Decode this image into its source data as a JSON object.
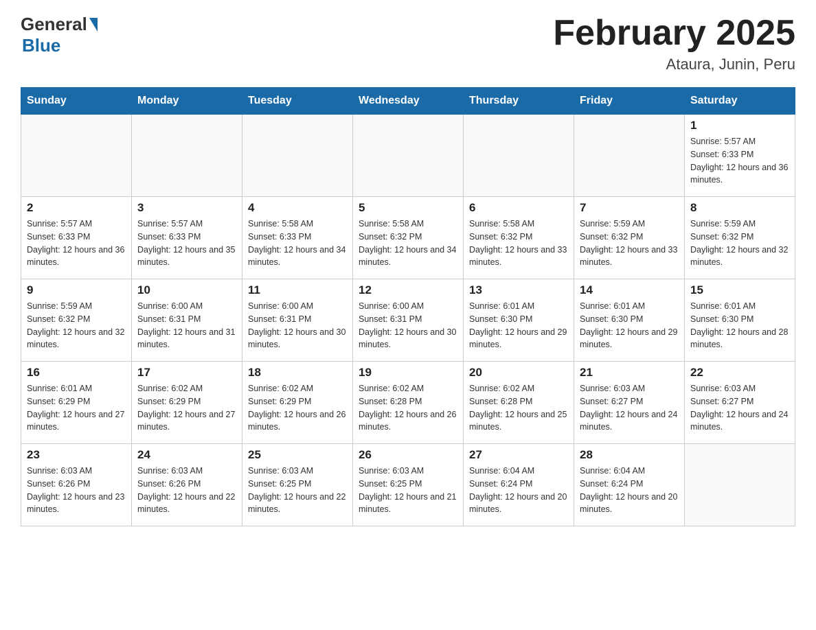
{
  "header": {
    "logo_general": "General",
    "logo_blue": "Blue",
    "title": "February 2025",
    "subtitle": "Ataura, Junin, Peru"
  },
  "days_of_week": [
    "Sunday",
    "Monday",
    "Tuesday",
    "Wednesday",
    "Thursday",
    "Friday",
    "Saturday"
  ],
  "weeks": [
    [
      {
        "day": "",
        "info": ""
      },
      {
        "day": "",
        "info": ""
      },
      {
        "day": "",
        "info": ""
      },
      {
        "day": "",
        "info": ""
      },
      {
        "day": "",
        "info": ""
      },
      {
        "day": "",
        "info": ""
      },
      {
        "day": "1",
        "info": "Sunrise: 5:57 AM\nSunset: 6:33 PM\nDaylight: 12 hours and 36 minutes."
      }
    ],
    [
      {
        "day": "2",
        "info": "Sunrise: 5:57 AM\nSunset: 6:33 PM\nDaylight: 12 hours and 36 minutes."
      },
      {
        "day": "3",
        "info": "Sunrise: 5:57 AM\nSunset: 6:33 PM\nDaylight: 12 hours and 35 minutes."
      },
      {
        "day": "4",
        "info": "Sunrise: 5:58 AM\nSunset: 6:33 PM\nDaylight: 12 hours and 34 minutes."
      },
      {
        "day": "5",
        "info": "Sunrise: 5:58 AM\nSunset: 6:32 PM\nDaylight: 12 hours and 34 minutes."
      },
      {
        "day": "6",
        "info": "Sunrise: 5:58 AM\nSunset: 6:32 PM\nDaylight: 12 hours and 33 minutes."
      },
      {
        "day": "7",
        "info": "Sunrise: 5:59 AM\nSunset: 6:32 PM\nDaylight: 12 hours and 33 minutes."
      },
      {
        "day": "8",
        "info": "Sunrise: 5:59 AM\nSunset: 6:32 PM\nDaylight: 12 hours and 32 minutes."
      }
    ],
    [
      {
        "day": "9",
        "info": "Sunrise: 5:59 AM\nSunset: 6:32 PM\nDaylight: 12 hours and 32 minutes."
      },
      {
        "day": "10",
        "info": "Sunrise: 6:00 AM\nSunset: 6:31 PM\nDaylight: 12 hours and 31 minutes."
      },
      {
        "day": "11",
        "info": "Sunrise: 6:00 AM\nSunset: 6:31 PM\nDaylight: 12 hours and 30 minutes."
      },
      {
        "day": "12",
        "info": "Sunrise: 6:00 AM\nSunset: 6:31 PM\nDaylight: 12 hours and 30 minutes."
      },
      {
        "day": "13",
        "info": "Sunrise: 6:01 AM\nSunset: 6:30 PM\nDaylight: 12 hours and 29 minutes."
      },
      {
        "day": "14",
        "info": "Sunrise: 6:01 AM\nSunset: 6:30 PM\nDaylight: 12 hours and 29 minutes."
      },
      {
        "day": "15",
        "info": "Sunrise: 6:01 AM\nSunset: 6:30 PM\nDaylight: 12 hours and 28 minutes."
      }
    ],
    [
      {
        "day": "16",
        "info": "Sunrise: 6:01 AM\nSunset: 6:29 PM\nDaylight: 12 hours and 27 minutes."
      },
      {
        "day": "17",
        "info": "Sunrise: 6:02 AM\nSunset: 6:29 PM\nDaylight: 12 hours and 27 minutes."
      },
      {
        "day": "18",
        "info": "Sunrise: 6:02 AM\nSunset: 6:29 PM\nDaylight: 12 hours and 26 minutes."
      },
      {
        "day": "19",
        "info": "Sunrise: 6:02 AM\nSunset: 6:28 PM\nDaylight: 12 hours and 26 minutes."
      },
      {
        "day": "20",
        "info": "Sunrise: 6:02 AM\nSunset: 6:28 PM\nDaylight: 12 hours and 25 minutes."
      },
      {
        "day": "21",
        "info": "Sunrise: 6:03 AM\nSunset: 6:27 PM\nDaylight: 12 hours and 24 minutes."
      },
      {
        "day": "22",
        "info": "Sunrise: 6:03 AM\nSunset: 6:27 PM\nDaylight: 12 hours and 24 minutes."
      }
    ],
    [
      {
        "day": "23",
        "info": "Sunrise: 6:03 AM\nSunset: 6:26 PM\nDaylight: 12 hours and 23 minutes."
      },
      {
        "day": "24",
        "info": "Sunrise: 6:03 AM\nSunset: 6:26 PM\nDaylight: 12 hours and 22 minutes."
      },
      {
        "day": "25",
        "info": "Sunrise: 6:03 AM\nSunset: 6:25 PM\nDaylight: 12 hours and 22 minutes."
      },
      {
        "day": "26",
        "info": "Sunrise: 6:03 AM\nSunset: 6:25 PM\nDaylight: 12 hours and 21 minutes."
      },
      {
        "day": "27",
        "info": "Sunrise: 6:04 AM\nSunset: 6:24 PM\nDaylight: 12 hours and 20 minutes."
      },
      {
        "day": "28",
        "info": "Sunrise: 6:04 AM\nSunset: 6:24 PM\nDaylight: 12 hours and 20 minutes."
      },
      {
        "day": "",
        "info": ""
      }
    ]
  ]
}
